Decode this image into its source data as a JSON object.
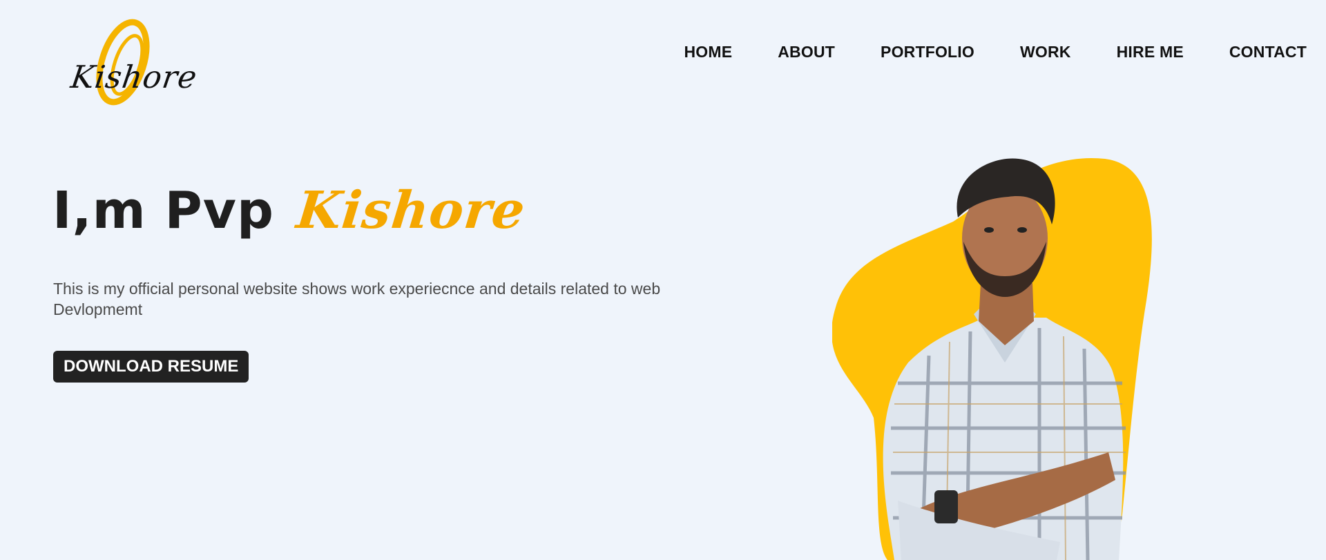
{
  "logo": {
    "text": "Kishore",
    "accent_color": "#f5b400"
  },
  "nav": {
    "items": [
      {
        "label": "HOME"
      },
      {
        "label": "ABOUT"
      },
      {
        "label": "PORTFOLIO"
      },
      {
        "label": "WORK"
      },
      {
        "label": "HIRE ME"
      },
      {
        "label": "CONTACT"
      }
    ]
  },
  "hero": {
    "title_prefix": "I,m Pvp ",
    "title_highlight": "Kishore",
    "highlight_color": "#f5a700",
    "description": "This is my official personal website shows work experiecnce and details related to web Devlopmemt",
    "button_label": "DOWNLOAD RESUME"
  },
  "portrait": {
    "blob_color": "#ffc107",
    "icon": "person-portrait"
  }
}
